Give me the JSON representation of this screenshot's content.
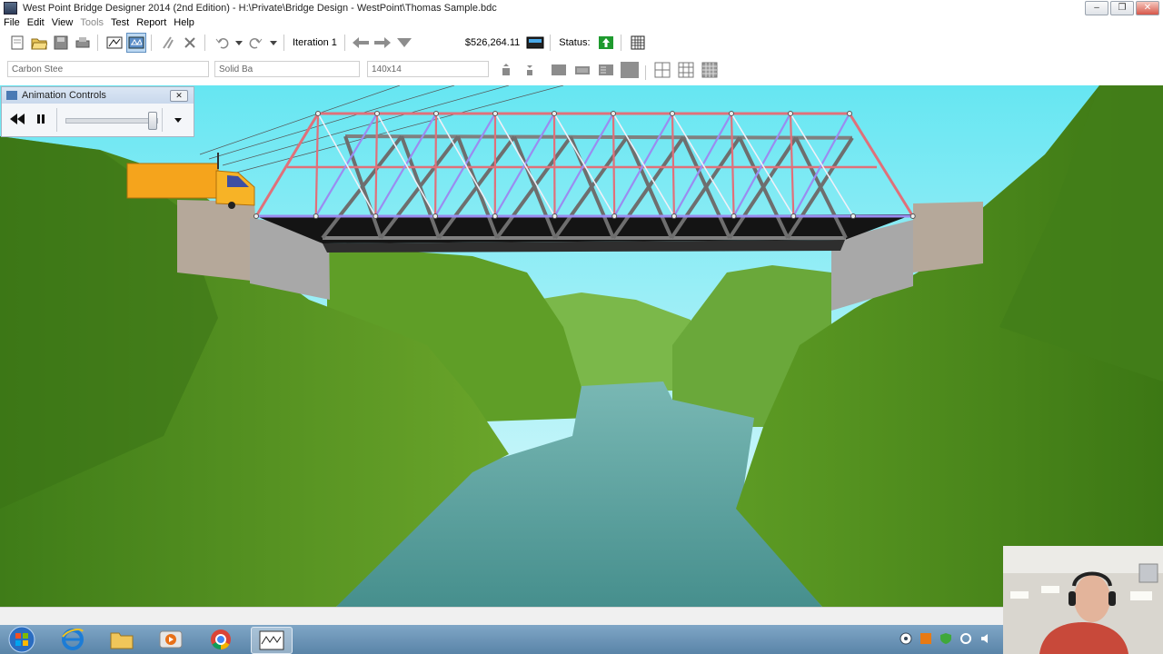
{
  "window": {
    "title": "West Point Bridge Designer 2014 (2nd Edition) - H:\\Private\\Bridge Design - WestPoint\\Thomas Sample.bdc",
    "minimize": "–",
    "maximize": "❐",
    "close": "✕"
  },
  "menu": [
    {
      "label": "File",
      "enabled": true
    },
    {
      "label": "Edit",
      "enabled": true
    },
    {
      "label": "View",
      "enabled": true
    },
    {
      "label": "Tools",
      "enabled": false
    },
    {
      "label": "Test",
      "enabled": true
    },
    {
      "label": "Report",
      "enabled": true
    },
    {
      "label": "Help",
      "enabled": true
    }
  ],
  "toolbar": {
    "iteration": "Iteration 1",
    "cost": "$526,264.11",
    "status_label": "Status:",
    "status_color": "#1e9a2e"
  },
  "properties": {
    "material": "Carbon Stee",
    "section": "Solid Ba",
    "size": "140x14"
  },
  "animation_controls": {
    "title": "Animation Controls",
    "close": "✕",
    "speed_fraction": 0.95
  },
  "colors": {
    "sky_top": "#66e6f2",
    "sky_bottom": "#e6fafc",
    "hill": "#4e8c1e",
    "river": "#4e9896",
    "truss_compression": "#e0707a",
    "truss_tension": "#9a8cf0",
    "truck": "#f5a41c"
  },
  "icons": {
    "new": "new-document-icon",
    "open": "open-folder-icon",
    "save": "save-icon",
    "print": "print-icon",
    "drawing_board": "drawing-board-icon",
    "load_test": "load-test-icon",
    "auto_correct": "auto-correct-icon",
    "delete": "delete-icon",
    "undo": "undo-icon",
    "redo": "redo-icon",
    "back": "arrow-left-icon",
    "forward": "arrow-right-icon",
    "iterations": "chevron-down-icon",
    "calculator": "calculator-icon",
    "status": "status-up-icon",
    "report": "report-grid-icon",
    "rewind": "rewind-icon",
    "pause": "pause-icon",
    "menu": "dropdown-icon"
  }
}
